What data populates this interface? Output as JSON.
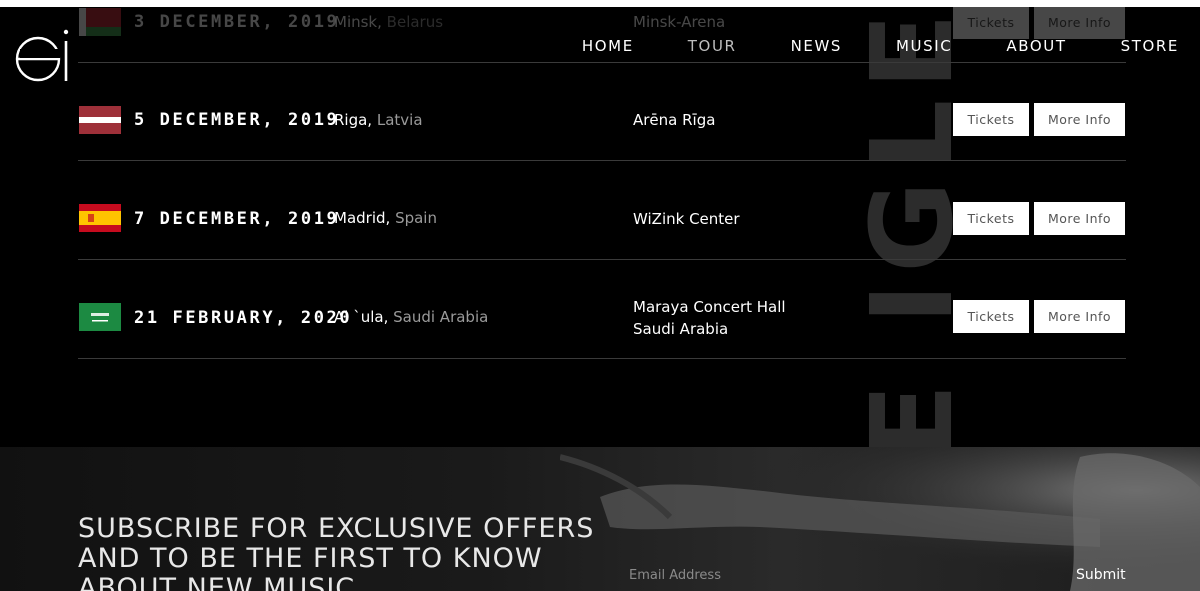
{
  "header": {
    "logo_text": "ei",
    "nav": [
      {
        "label": "HOME",
        "active": false
      },
      {
        "label": "TOUR",
        "active": true
      },
      {
        "label": "NEWS",
        "active": false
      },
      {
        "label": "MUSIC",
        "active": false
      },
      {
        "label": "ABOUT",
        "active": false
      },
      {
        "label": "STORE",
        "active": false
      }
    ]
  },
  "backdrop_text": "E IGLESIAS",
  "tour": {
    "tickets_label": "Tickets",
    "more_info_label": "More Info",
    "rows": [
      {
        "flag": "belarus-flag",
        "date": "3 DECEMBER, 2019",
        "city": "Minsk,",
        "country": "Belarus",
        "venue_line1": "Minsk-Arena",
        "venue_line2": ""
      },
      {
        "flag": "latvia-flag",
        "date": "5 DECEMBER, 2019",
        "city": "Riga,",
        "country": "Latvia",
        "venue_line1": "Arēna Rīga",
        "venue_line2": ""
      },
      {
        "flag": "spain-flag",
        "date": "7 DECEMBER, 2019",
        "city": "Madrid,",
        "country": "Spain",
        "venue_line1": "WiZink Center",
        "venue_line2": ""
      },
      {
        "flag": "saudi-arabia-flag",
        "date": "21 FEBRUARY, 2020",
        "city": "Al `ula,",
        "country": "Saudi Arabia",
        "venue_line1": "Maraya Concert Hall",
        "venue_line2": "Saudi Arabia"
      }
    ]
  },
  "subscribe": {
    "title": "SUBSCRIBE FOR EXCLUSIVE OFFERS AND TO BE THE FIRST TO KNOW ABOUT NEW MUSIC",
    "email_placeholder": "Email Address",
    "submit_label": "Submit"
  }
}
